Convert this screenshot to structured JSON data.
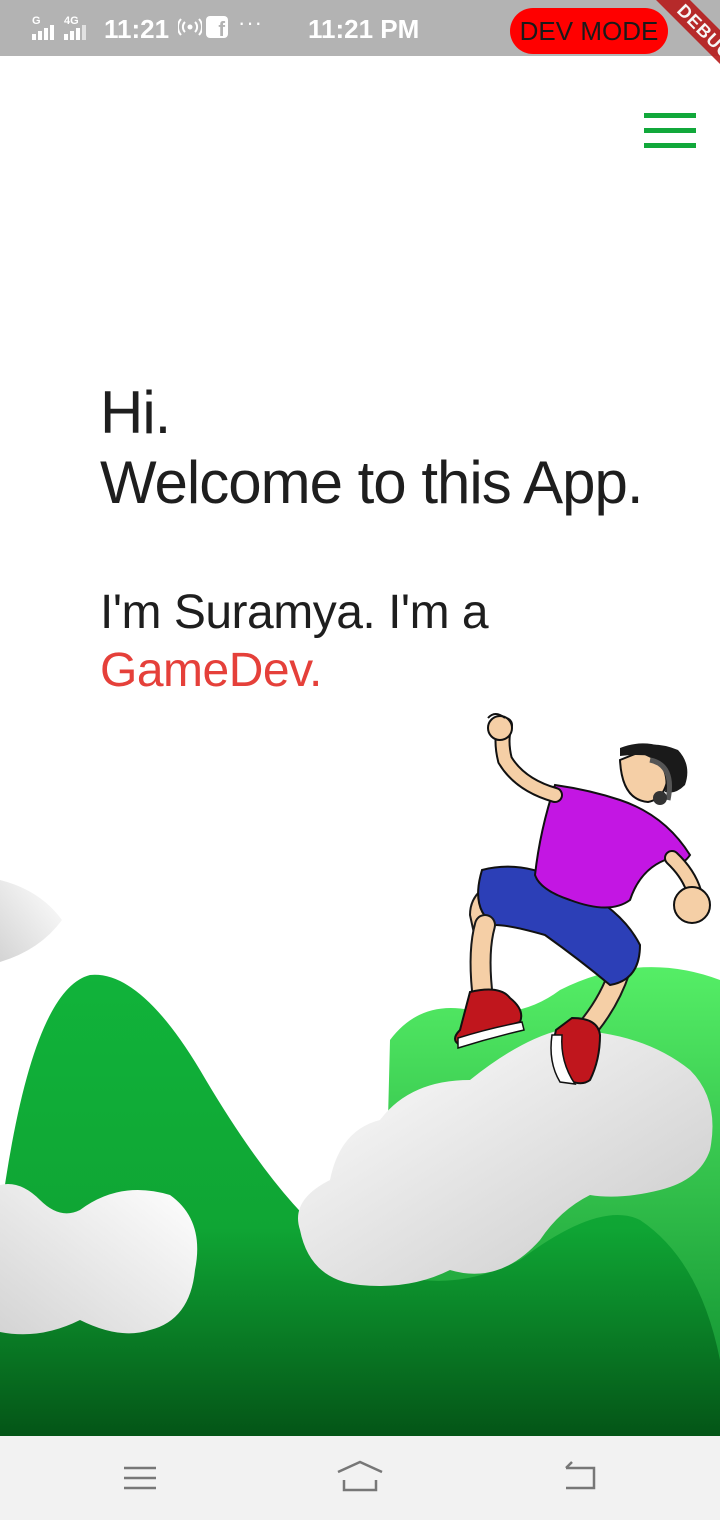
{
  "status_bar": {
    "time_left": "11:21",
    "time_center": "11:21 PM",
    "network_label": "4G",
    "signal_label": "G",
    "more_indicator": "···",
    "facebook_glyph": "f"
  },
  "debug": {
    "dev_mode_label": "DEV MODE",
    "ribbon_label": "DEBUG"
  },
  "header": {
    "menu_icon": "hamburger-menu-icon"
  },
  "main": {
    "greeting_line1": "Hi.",
    "greeting_line2": "Welcome to this App.",
    "intro_text": "I'm Suramya. I'm a",
    "role_text": "GameDev."
  },
  "nav_bar": {
    "icons": [
      "menu-icon",
      "home-icon",
      "back-icon"
    ]
  },
  "colors": {
    "accent_green": "#11a83b",
    "role_red": "#e5403a",
    "dev_mode_red": "#ff0000",
    "status_bar_gray": "#b3b3b3"
  }
}
